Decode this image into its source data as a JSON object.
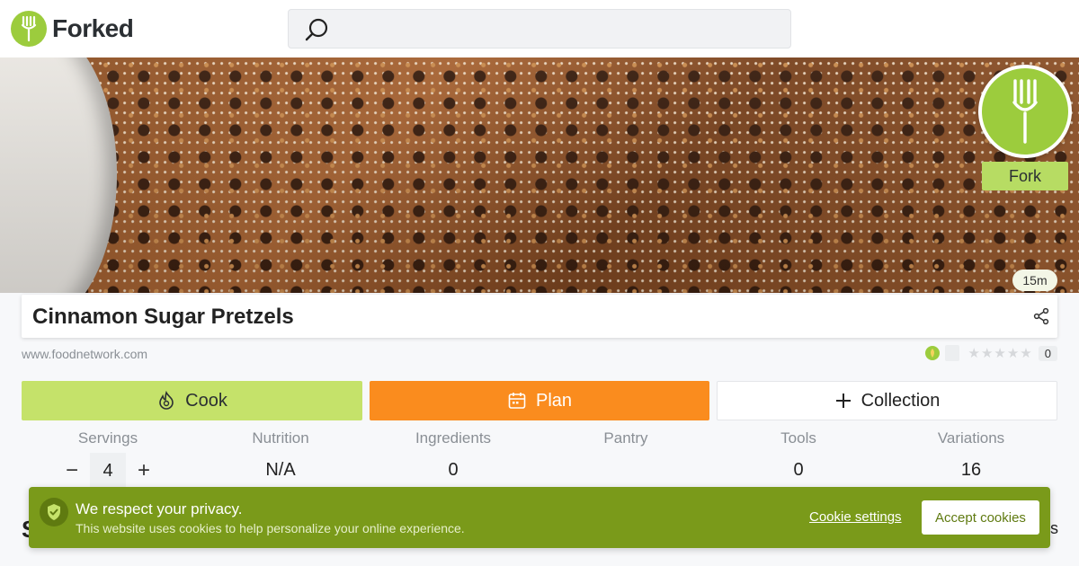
{
  "brand": {
    "name": "Forked",
    "color": "#9ccc3d"
  },
  "search": {
    "placeholder": "",
    "icon": "search-icon"
  },
  "hero": {
    "fork_label": "Fork",
    "time": "15m"
  },
  "recipe": {
    "title": "Cinnamon Sugar Pretzels",
    "source": "www.foodnetwork.com",
    "rating_stars": 0,
    "rating_count": "0"
  },
  "actions": {
    "cook": {
      "label": "Cook",
      "color": "#c5e26a"
    },
    "plan": {
      "label": "Plan",
      "color": "#fa8c1e"
    },
    "collection": {
      "label": "Collection"
    }
  },
  "stats": [
    {
      "label": "Servings",
      "value": "4"
    },
    {
      "label": "Nutrition",
      "value": "N/A"
    },
    {
      "label": "Ingredients",
      "value": "0"
    },
    {
      "label": "Pantry",
      "value": ""
    },
    {
      "label": "Tools",
      "value": "0"
    },
    {
      "label": "Variations",
      "value": "16"
    }
  ],
  "servings_controls": {
    "minus": "−",
    "plus": "+"
  },
  "cookie": {
    "title": "We respect your privacy.",
    "text": "This website uses cookies to help personalize your online experience.",
    "settings_label": "Cookie settings",
    "accept_label": "Accept cookies",
    "color": "#7a9a1a"
  },
  "partial": {
    "left_letter": "S",
    "right_letter": "s"
  }
}
